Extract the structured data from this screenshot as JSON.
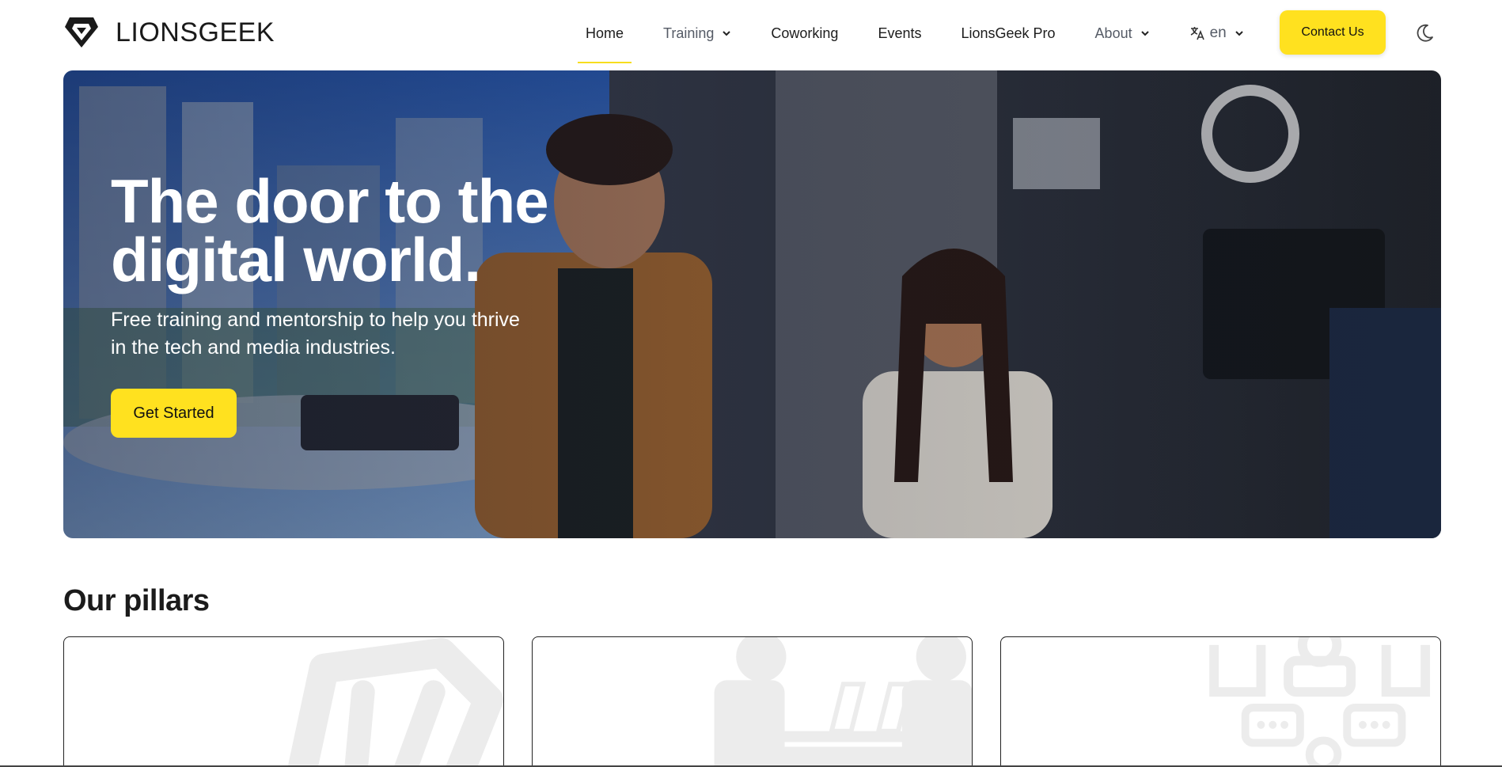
{
  "header": {
    "brand": "LIONSGEEK",
    "nav": [
      {
        "label": "Home",
        "active": true,
        "dropdown": false
      },
      {
        "label": "Training",
        "active": false,
        "dropdown": true
      },
      {
        "label": "Coworking",
        "active": false,
        "dropdown": false
      },
      {
        "label": "Events",
        "active": false,
        "dropdown": false
      },
      {
        "label": "LionsGeek Pro",
        "active": false,
        "dropdown": false
      },
      {
        "label": "About",
        "active": false,
        "dropdown": true
      }
    ],
    "language": "en",
    "contact_label": "Contact Us",
    "icons": {
      "logo": "lion-shield-logo",
      "language": "translate-icon",
      "theme": "moon-icon",
      "chevron": "chevron-down-icon"
    }
  },
  "hero": {
    "title": "The door to the digital world.",
    "subtitle": "Free training and mentorship to help you thrive in the tech and media industries.",
    "cta_label": "Get Started"
  },
  "pillars": {
    "heading": "Our pillars",
    "cards": [
      {
        "icon": "code-icon"
      },
      {
        "icon": "coworking-desk-icon"
      },
      {
        "icon": "community-chat-icon"
      }
    ]
  },
  "colors": {
    "accent": "#ffe11f",
    "active_underline": "#f7dd1e",
    "text": "#111111",
    "muted_text": "#555b66"
  }
}
